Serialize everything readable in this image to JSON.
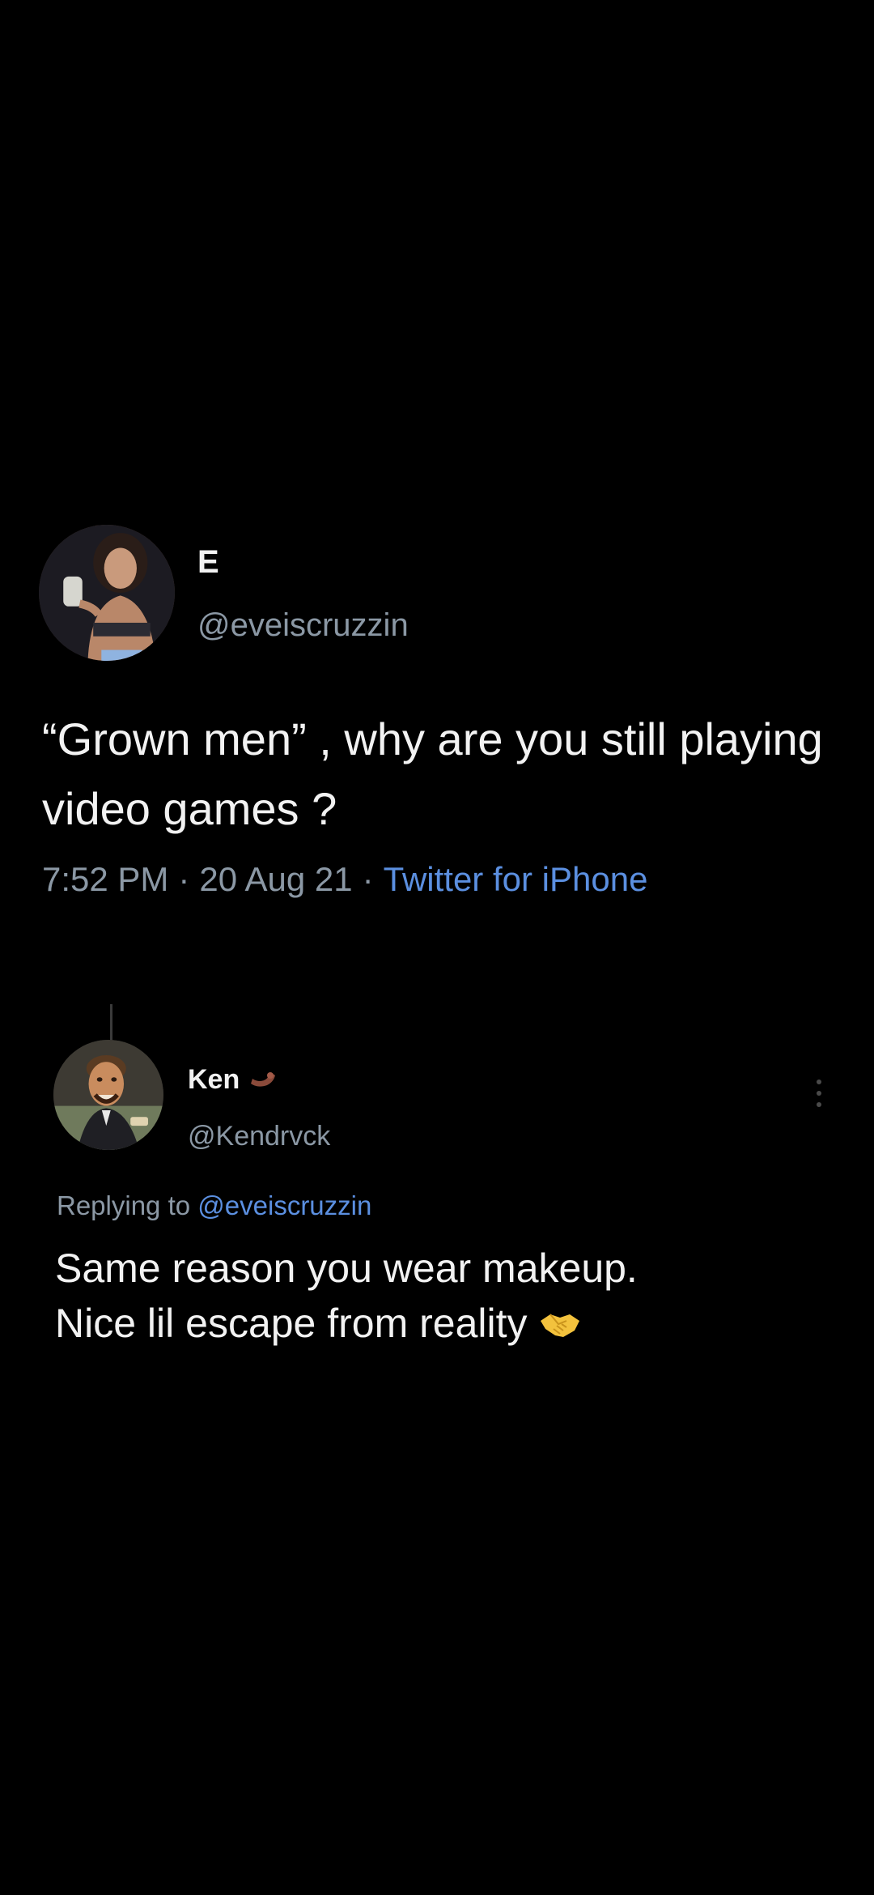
{
  "original_tweet": {
    "display_name": "E",
    "handle": "@eveiscruzzin",
    "text": "“Grown men” , why are you still playing video games ?",
    "time": "7:52 PM",
    "date": "20 Aug 21",
    "source": "Twitter for iPhone",
    "avatar_icon": "profile-photo-woman"
  },
  "reply_tweet": {
    "display_name": "Ken",
    "name_emoji_icon": "flexed-arm-icon",
    "handle": "@Kendrvck",
    "replying_prefix": "Replying to",
    "replying_to": "@eveiscruzzin",
    "text_line_1": "Same reason you wear makeup.",
    "text_line_2": "Nice lil escape from reality",
    "trailing_emoji_icon": "handshake-icon",
    "more_icon": "vertical-ellipsis-icon",
    "avatar_icon": "profile-photo-laughing-man"
  },
  "colors": {
    "background": "#000000",
    "primary_text": "#f2f2f2",
    "secondary_text": "#8b98a5",
    "link": "#5b8fe0"
  },
  "separator": "·"
}
